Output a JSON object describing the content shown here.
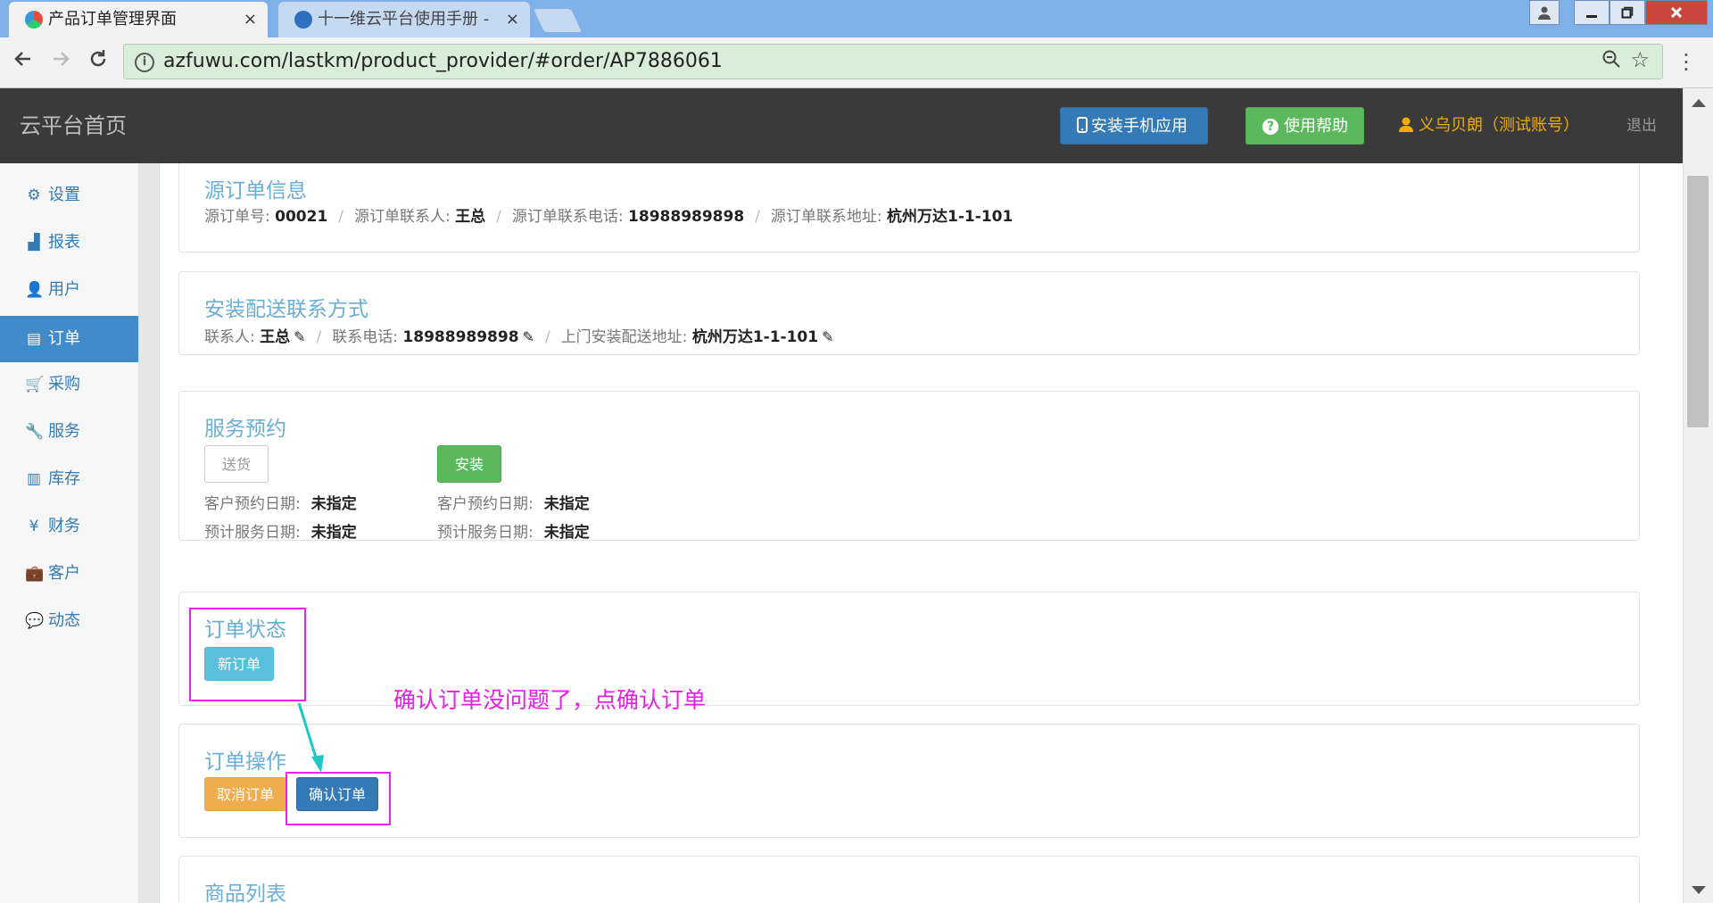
{
  "browser": {
    "tabs": [
      {
        "title": "产品订单管理界面",
        "active": true,
        "icon": "app-favicon-icon"
      },
      {
        "title": "十一维云平台使用手册 -",
        "active": false,
        "icon": "doc-favicon-icon"
      }
    ],
    "close_glyph": "×",
    "url": "azfuwu.com/lastkm/product_provider/#order/AP7886061"
  },
  "header": {
    "brand": "云平台首页",
    "install_app_label": "安装手机应用",
    "help_label": "使用帮助",
    "user_label": "义乌贝朗（测试账号）",
    "logout_label": "退出"
  },
  "sidebar": {
    "items": [
      {
        "label": "设置",
        "icon": "gear-icon",
        "glyph": "⚙",
        "active": false
      },
      {
        "label": "报表",
        "icon": "bar-chart-icon",
        "glyph": "▟",
        "active": false
      },
      {
        "label": "用户",
        "icon": "user-icon",
        "glyph": "👤",
        "active": false
      },
      {
        "label": "订单",
        "icon": "list-icon",
        "glyph": "▤",
        "active": true
      },
      {
        "label": "采购",
        "icon": "cart-icon",
        "glyph": "🛒",
        "active": false
      },
      {
        "label": "服务",
        "icon": "wrench-icon",
        "glyph": "🔧",
        "active": false
      },
      {
        "label": "库存",
        "icon": "barcode-icon",
        "glyph": "▥",
        "active": false
      },
      {
        "label": "财务",
        "icon": "yen-icon",
        "glyph": "¥",
        "active": false
      },
      {
        "label": "客户",
        "icon": "briefcase-icon",
        "glyph": "💼",
        "active": false
      },
      {
        "label": "动态",
        "icon": "comment-icon",
        "glyph": "💬",
        "active": false
      }
    ]
  },
  "source_order": {
    "title": "源订单信息",
    "order_no_label": "源订单号:",
    "order_no": "00021",
    "contact_label": "源订单联系人:",
    "contact": "王总",
    "phone_label": "源订单联系电话:",
    "phone": "18988989898",
    "address_label": "源订单联系地址:",
    "address": "杭州万达1-1-101",
    "separator": "/"
  },
  "delivery_contact": {
    "title": "安装配送联系方式",
    "contact_label": "联系人:",
    "contact": "王总",
    "phone_label": "联系电话:",
    "phone": "18988989898",
    "address_label": "上门安装配送地址:",
    "address": "杭州万达1-1-101",
    "separator": "/",
    "edit_glyph": "✎"
  },
  "service_booking": {
    "title": "服务预约",
    "delivery": {
      "button_label": "送货",
      "customer_date_label": "客户预约日期:",
      "customer_date": "未指定",
      "planned_date_label": "预计服务日期:",
      "planned_date": "未指定"
    },
    "install": {
      "button_label": "安装",
      "customer_date_label": "客户预约日期:",
      "customer_date": "未指定",
      "planned_date_label": "预计服务日期:",
      "planned_date": "未指定"
    }
  },
  "order_status": {
    "title": "订单状态",
    "badge": "新订单"
  },
  "order_ops": {
    "title": "订单操作",
    "cancel_label": "取消订单",
    "confirm_label": "确认订单"
  },
  "product_list": {
    "title": "商品列表"
  },
  "annotation": {
    "text": "确认订单没问题了，点确认订单"
  },
  "colors": {
    "accent_blue": "#337ab7",
    "success_green": "#5cb85c",
    "info_cyan": "#5bc0de",
    "warning_orange": "#f0ad4e",
    "annotation_magenta": "#ee22ee",
    "arrow_teal": "#1fc7c7"
  }
}
